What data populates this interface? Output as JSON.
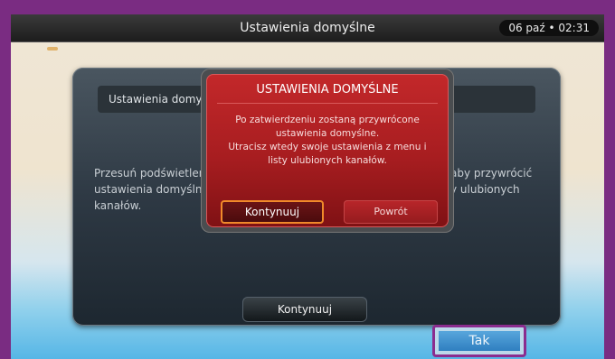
{
  "header": {
    "title": "Ustawienia domyślne",
    "clock": "06 paź • 02:31"
  },
  "panel": {
    "heading": "Ustawienia domyś",
    "text_lines": [
      "Przesuń podświetlenie",
      "ustawienia domyślne.",
      "kanałów."
    ],
    "text_right_lines": [
      "aby przywrócić",
      "y ulubionych"
    ],
    "continue_label": "Kontynuuj",
    "yes_label": "Tak"
  },
  "dialog": {
    "title": "USTAWIENIA DOMYŚLNE",
    "message_lines": [
      "Po zatwierdzeniu zostaną przywrócone",
      "ustawienia domyślne.",
      "Utracisz wtedy swoje ustawienia z menu i",
      "listy ulubionych kanałów."
    ],
    "continue_label": "Kontynuuj",
    "back_label": "Powrót"
  },
  "colors": {
    "frame": "#7a2c82",
    "dialog_red": "#b2211f",
    "focus_orange": "#f08a2a",
    "selected_blue": "#3a8fcf"
  }
}
